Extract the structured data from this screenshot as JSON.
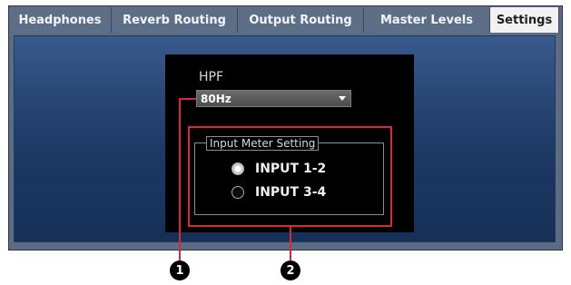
{
  "tabs": [
    {
      "label": "Headphones"
    },
    {
      "label": "Reverb Routing"
    },
    {
      "label": "Output Routing"
    },
    {
      "label": "Master Levels"
    },
    {
      "label": "Settings",
      "active": true
    }
  ],
  "hpf": {
    "label": "HPF",
    "selected_value": "80Hz"
  },
  "input_meter_setting": {
    "legend": "Input Meter Setting",
    "options": [
      {
        "label": "INPUT 1-2",
        "selected": true
      },
      {
        "label": "INPUT 3-4",
        "selected": false
      }
    ]
  },
  "callouts": [
    "1",
    "2"
  ],
  "colors": {
    "highlight": "#d8283a",
    "tab_bar": "#5d6e87",
    "active_tab": "#f1f1f1",
    "panel": "#000000"
  }
}
